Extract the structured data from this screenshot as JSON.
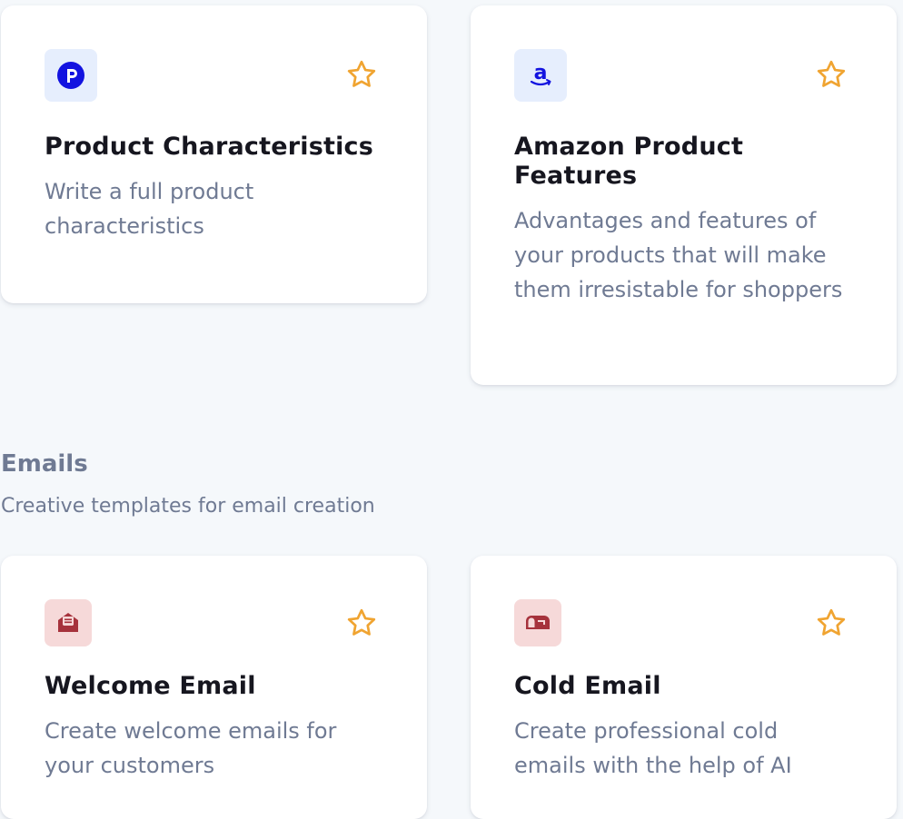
{
  "cards_top": [
    {
      "title": "Product Characteristics",
      "description": "Write a full product characteristics",
      "icon": "product-p-icon",
      "icon_bg": "#e6eefd",
      "icon_color": "#1313e0"
    },
    {
      "title": "Amazon Product Features",
      "description": "Advantages and features of your products that will make them irresistable for shoppers",
      "icon": "amazon-icon",
      "icon_bg": "#e6eefd",
      "icon_color": "#1313e0"
    }
  ],
  "emails_section": {
    "title": "Emails",
    "subtitle": "Creative templates for email creation",
    "cards": [
      {
        "title": "Welcome Email",
        "description": "Create welcome emails for your customers",
        "icon": "open-envelope-icon",
        "icon_bg": "#f6d9d9",
        "icon_color": "#a6323c"
      },
      {
        "title": "Cold Email",
        "description": "Create professional cold emails with the help of AI",
        "icon": "mailbox-icon",
        "icon_bg": "#f6d9d9",
        "icon_color": "#a6323c"
      }
    ]
  },
  "star_color": "#f0a431"
}
